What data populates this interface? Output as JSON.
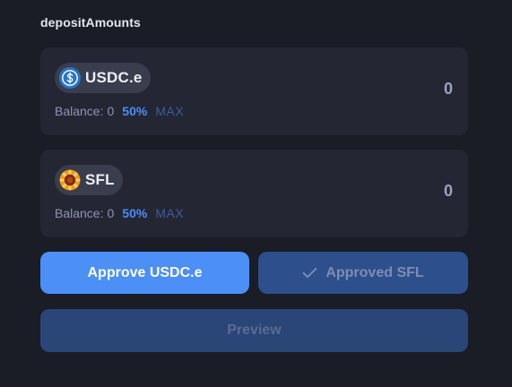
{
  "section": {
    "title": "depositAmounts"
  },
  "tokens": [
    {
      "symbol": "USDC.e",
      "icon": "usdc-icon",
      "balance_label": "Balance:",
      "balance_value": "0",
      "half_label": "50%",
      "max_label": "MAX",
      "amount": "0"
    },
    {
      "symbol": "SFL",
      "icon": "sfl-icon",
      "balance_label": "Balance:",
      "balance_value": "0",
      "half_label": "50%",
      "max_label": "MAX",
      "amount": "0"
    }
  ],
  "buttons": {
    "approve_label": "Approve USDC.e",
    "approved_label": "Approved SFL",
    "approved_icon": "checkmark-icon",
    "preview_label": "Preview"
  },
  "colors": {
    "background": "#1a1c26",
    "card": "#242634",
    "accent": "#4c8ff7",
    "approved_bg": "#2d4f8c",
    "preview_bg": "#2a4578"
  }
}
